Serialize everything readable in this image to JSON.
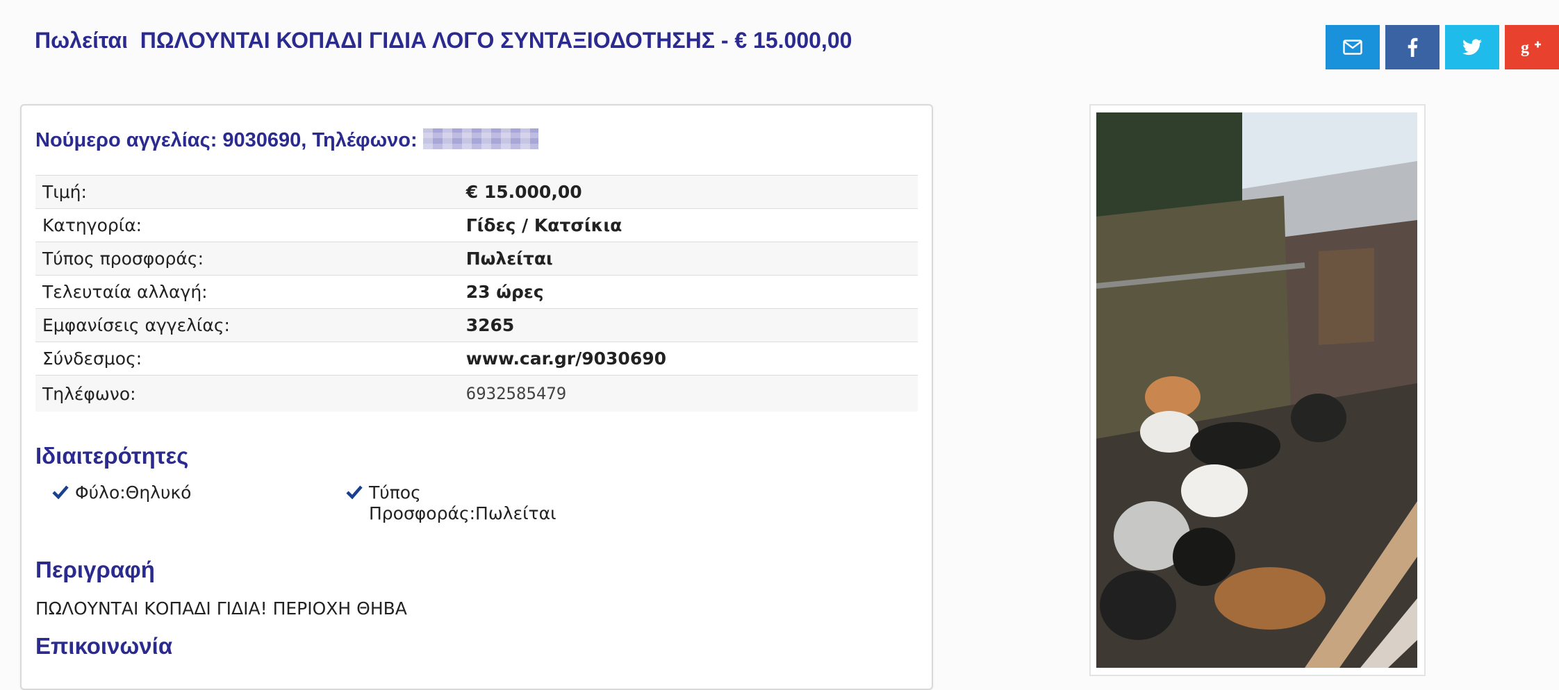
{
  "title": "Πωλείται  ΠΩΛΟΥΝΤΑΙ ΚΟΠΑΔΙ ΓΙΔΙΑ ΛΟΓΟ ΣΥΝΤΑΞΙΟΔΟΤΗΣΗΣ - € 15.000,00",
  "share": [
    {
      "icon": "envelope-icon",
      "color": "#1a92db"
    },
    {
      "icon": "facebook-icon",
      "color": "#3a63a3"
    },
    {
      "icon": "twitter-icon",
      "color": "#1ebbeb"
    },
    {
      "icon": "google-plus-icon",
      "color": "#e8412d"
    }
  ],
  "ad_header": "Νούμερο αγγελίας: 9030690, Τηλέφωνο:",
  "details": [
    {
      "label": "Τιμή:",
      "value": "€ 15.000,00"
    },
    {
      "label": "Κατηγορία:",
      "value": "Γίδες / Κατσίκια"
    },
    {
      "label": "Τύπος προσφοράς:",
      "value": "Πωλείται"
    },
    {
      "label": "Τελευταία αλλαγή:",
      "value": "23 ώρες"
    },
    {
      "label": "Εμφανίσεις αγγελίας:",
      "value": "3265"
    },
    {
      "label": "Σύνδεσμος:",
      "value": "www.car.gr/9030690"
    },
    {
      "label": "Τηλέφωνο:",
      "value": "6932585479"
    }
  ],
  "features_title": "Ιδιαιτερότητες",
  "features": [
    {
      "text": "Φύλο:Θηλυκό"
    },
    {
      "line1": "Τύπος",
      "line2": "Προσφοράς:Πωλείται"
    }
  ],
  "description_title": "Περιγραφή",
  "description": "ΠΩΛΟΥΝΤΑΙ ΚΟΠΑΔΙ ΓΙΔΙΑ! ΠΕΡΙΟΧΗ ΘΗΒΑ",
  "contact_title": "Επικοινωνία",
  "colors": {
    "heading": "#2b2a8e",
    "check": "#1b3f8f"
  }
}
